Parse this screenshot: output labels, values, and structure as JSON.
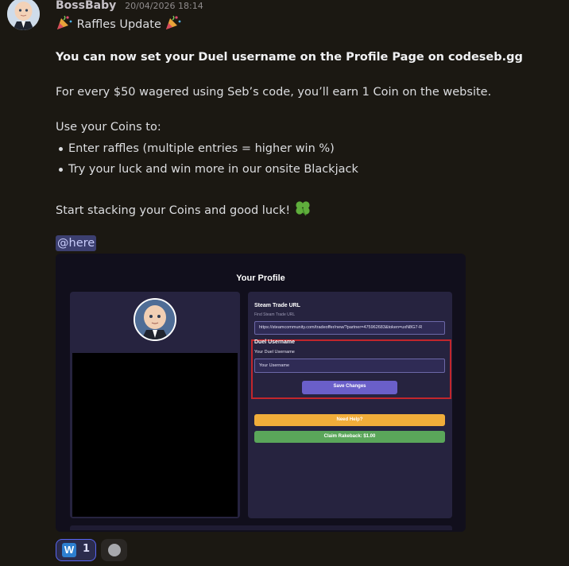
{
  "message": {
    "author": "BossBaby",
    "timestamp": "20/04/2026 18:14",
    "title": "Raffles Update",
    "headline": "You can now set your Duel username on the Profile Page on codeseb.gg",
    "earn_line": "For every $50 wagered using Seb’s code, you’ll earn 1 Coin on the website.",
    "use_intro": "Use your Coins to:",
    "bullets": [
      "Enter raffles (multiple entries = higher win %)",
      "Try your luck and win more in our onsite Blackjack"
    ],
    "closing": "Start stacking your Coins and good luck!",
    "mention": "@here"
  },
  "embed": {
    "page_title": "Your Profile",
    "steam_section_title": "Steam Trade URL",
    "steam_help": "Find Steam Trade URL",
    "steam_url_value": "https://steamcommunity.com/tradeoffer/new/?partner=475962683&token=uxN8G7-R",
    "duel_section_title": "Duel Username",
    "duel_label": "Your Duel Username",
    "duel_placeholder": "Your Username",
    "save_button": "Save Changes",
    "help_button": "Need Help?",
    "rakeback_button": "Claim Rakeback: $1.00"
  },
  "reactions": [
    {
      "emoji": "W",
      "count": "1"
    }
  ],
  "icons": {
    "title_decoration": "party-popper-icon",
    "closing_decoration": "four-leaf-clover-icon",
    "add_reaction": "smiley-icon"
  },
  "colors": {
    "background": "#1b1812",
    "mention_bg": "#3c3f70",
    "mention_text": "#c9cdfb",
    "embed_bg": "#110f1c",
    "card_bg": "#26233f",
    "save_button": "#6a5fc9",
    "help_button": "#f1ad3a",
    "rakeback_button": "#5aa65a",
    "highlight_box": "#c2262c"
  }
}
